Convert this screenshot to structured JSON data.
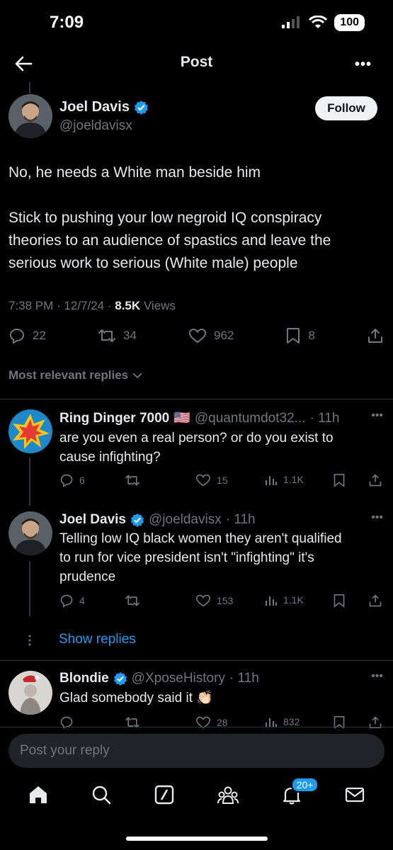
{
  "status_bar": {
    "time": "7:09",
    "battery": "100"
  },
  "header": {
    "title": "Post"
  },
  "post": {
    "author_name": "Joel Davis",
    "handle": "@joeldavisx",
    "follow_label": "Follow",
    "text_line1": "No, he needs a White man beside him",
    "text_p2_l1": "Stick to pushing your low negroid IQ conspiracy",
    "text_p2_l2": "theories to an audience of spastics and leave the",
    "text_p2_l3": "serious work to serious (White male) people",
    "timestamp": "7:38 PM · 12/7/24 · ",
    "views_count": "8.5K",
    "views_label": " Views",
    "replies": "22",
    "reposts": "34",
    "likes": "962",
    "bookmarks": "8"
  },
  "sort": {
    "label": "Most relevant replies"
  },
  "replies": [
    {
      "name": "Ring Dinger 7000",
      "flag": "🇺🇸",
      "handle": "@quantumdot32...",
      "time": "· 11h",
      "text_l1": "are you even a real person?  or do you exist to",
      "text_l2": "cause infighting?",
      "reply_count": "6",
      "likes": "15",
      "views": "1.1K"
    },
    {
      "name": "Joel Davis",
      "handle": "@joeldavisx",
      "time": "· 11h",
      "text_l1": "Telling low IQ black women they aren't qualified",
      "text_l2": "to run for vice president isn't \"infighting\" it's",
      "text_l3": "prudence",
      "reply_count": "4",
      "likes": "153",
      "views": "1.1K"
    },
    {
      "name": "Blondie",
      "handle": "@XposeHistory",
      "time": "· 11h",
      "text_l1": "Glad somebody said it 👏🏻",
      "likes": "28",
      "views": "832"
    }
  ],
  "show_replies": "Show replies",
  "compose": {
    "placeholder": "Post your reply"
  },
  "tabbar": {
    "notifications_badge": "20+"
  },
  "colors": {
    "accent": "#1d9bf0",
    "background": "#000000",
    "muted": "#71767b",
    "text": "#e7e9ea"
  }
}
